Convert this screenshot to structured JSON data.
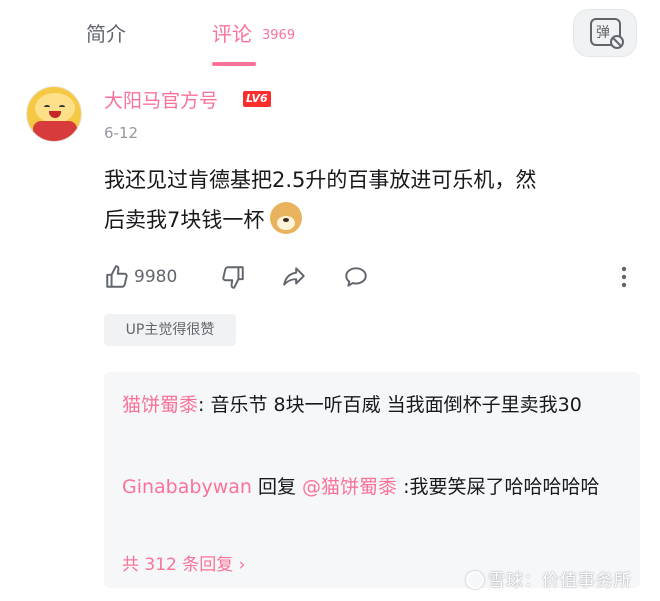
{
  "tabs": {
    "intro_label": "简介",
    "comments_label": "评论",
    "comments_count": "3969",
    "active_color": "#fb7299"
  },
  "danmaku_toggle": {
    "glyph": "弹",
    "icon": "danmaku-off-icon"
  },
  "comment": {
    "username": "大阳马官方号",
    "level": "LV6",
    "date": "6-12",
    "text_line1": "我还见过肯德基把2.5升的百事放进可乐机，然",
    "text_line2": "后卖我7块钱一杯",
    "emoji": "doge-emoji",
    "like_count": "9980",
    "up_liked_label": "UP主觉得很赞"
  },
  "replies": {
    "items": [
      {
        "author": "猫饼蜀黍",
        "separator": ":",
        "text": " 音乐节 8块一听百威 当我面倒杯子里卖我30"
      },
      {
        "author": "Ginababywan",
        "reply_word": " 回复 ",
        "mention": "@猫饼蜀黍",
        "text": " :我要笑屎了哈哈哈哈哈"
      }
    ],
    "total_label": "共 312 条回复 ›"
  },
  "watermark": {
    "text": "雪球：价值事务所"
  }
}
